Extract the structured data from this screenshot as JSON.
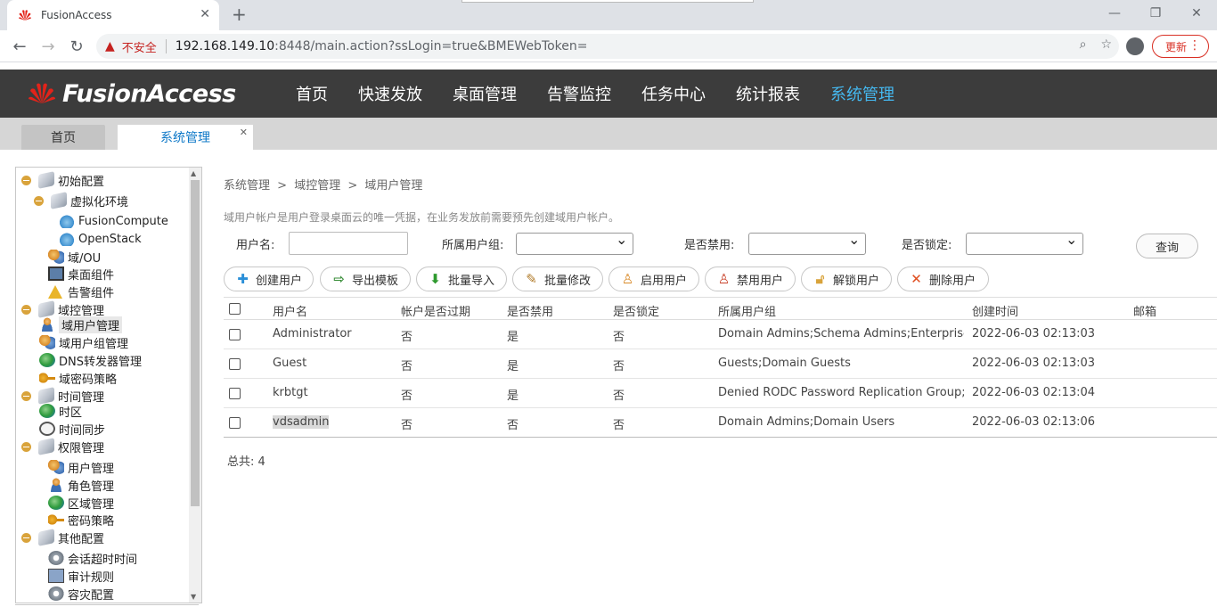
{
  "browser": {
    "tab_title": "FusionAccess",
    "security_label": "不安全",
    "url_host": "192.168.149.10",
    "url_rest": ":8448/main.action?ssLogin=true&BMEWebToken=",
    "update_label": "更新"
  },
  "app": {
    "logo_text": "FusionAccess",
    "nav": [
      "首页",
      "快速发放",
      "桌面管理",
      "告警监控",
      "任务中心",
      "统计报表",
      "系统管理"
    ],
    "active_nav": "系统管理"
  },
  "pagetabs": {
    "home": "首页",
    "current": "系统管理"
  },
  "tree": [
    {
      "label": "初始配置",
      "icon": "folder-icon"
    },
    {
      "label": "虚拟化环境",
      "icon": "folder-icon"
    },
    {
      "label": "FusionCompute",
      "icon": "cloud-icon"
    },
    {
      "label": "OpenStack",
      "icon": "cloud-icon"
    },
    {
      "label": "域/OU",
      "icon": "users-icon"
    },
    {
      "label": "桌面组件",
      "icon": "monitor-icon"
    },
    {
      "label": "告警组件",
      "icon": "warning-icon"
    },
    {
      "label": "域控管理",
      "icon": "folder-icon"
    },
    {
      "label": "域用户管理",
      "icon": "user-icon"
    },
    {
      "label": "域用户组管理",
      "icon": "users-icon"
    },
    {
      "label": "DNS转发器管理",
      "icon": "globe-icon"
    },
    {
      "label": "域密码策略",
      "icon": "key-icon"
    },
    {
      "label": "时间管理",
      "icon": "folder-icon"
    },
    {
      "label": "时区",
      "icon": "globe-icon"
    },
    {
      "label": "时间同步",
      "icon": "clock-icon"
    },
    {
      "label": "权限管理",
      "icon": "folder-icon"
    },
    {
      "label": "用户管理",
      "icon": "users-icon"
    },
    {
      "label": "角色管理",
      "icon": "user-icon"
    },
    {
      "label": "区域管理",
      "icon": "globe-icon"
    },
    {
      "label": "密码策略",
      "icon": "key-icon"
    },
    {
      "label": "其他配置",
      "icon": "folder-icon"
    },
    {
      "label": "会话超时时间",
      "icon": "gear-icon"
    },
    {
      "label": "审计规则",
      "icon": "report-icon"
    },
    {
      "label": "容灾配置",
      "icon": "gear-icon"
    }
  ],
  "selected_tree_item": "域用户管理",
  "breadcrumb": [
    "系统管理",
    ">",
    "域控管理",
    ">",
    "域用户管理"
  ],
  "description": "域用户帐户是用户登录桌面云的唯一凭据，在业务发放前需要预先创建域用户帐户。",
  "filters": {
    "username_label": "用户名:",
    "username_value": "",
    "group_label": "所属用户组:",
    "disabled_label": "是否禁用:",
    "locked_label": "是否锁定:",
    "query_label": "查询"
  },
  "actions": [
    {
      "label": "创建用户",
      "icon": "plus-icon"
    },
    {
      "label": "导出模板",
      "icon": "export-icon"
    },
    {
      "label": "批量导入",
      "icon": "download-arrow-icon"
    },
    {
      "label": "批量修改",
      "icon": "edit-icon"
    },
    {
      "label": "启用用户",
      "icon": "enable-user-icon"
    },
    {
      "label": "禁用用户",
      "icon": "disable-user-icon"
    },
    {
      "label": "解锁用户",
      "icon": "unlock-icon"
    },
    {
      "label": "删除用户",
      "icon": "delete-x-icon"
    }
  ],
  "table": {
    "columns": [
      "用户名",
      "帐户是否过期",
      "是否禁用",
      "是否锁定",
      "所属用户组",
      "创建时间",
      "邮箱"
    ],
    "rows": [
      [
        "Administrator",
        "否",
        "是",
        "否",
        "Domain Admins;Schema Admins;Enterprise ...",
        "2022-06-03 02:13:03",
        ""
      ],
      [
        "Guest",
        "否",
        "是",
        "否",
        "Guests;Domain Guests",
        "2022-06-03 02:13:03",
        ""
      ],
      [
        "krbtgt",
        "否",
        "是",
        "否",
        "Denied RODC Password Replication Group;D...",
        "2022-06-03 02:13:04",
        ""
      ],
      [
        "vdsadmin",
        "否",
        "否",
        "否",
        "Domain Admins;Domain Users",
        "2022-06-03 02:13:06",
        ""
      ]
    ]
  },
  "total_label": "总共: 4",
  "colors": {
    "header_bg": "#3c3c3c",
    "active_nav": "#45b8ef",
    "tab_active_text": "#0e78c7"
  }
}
